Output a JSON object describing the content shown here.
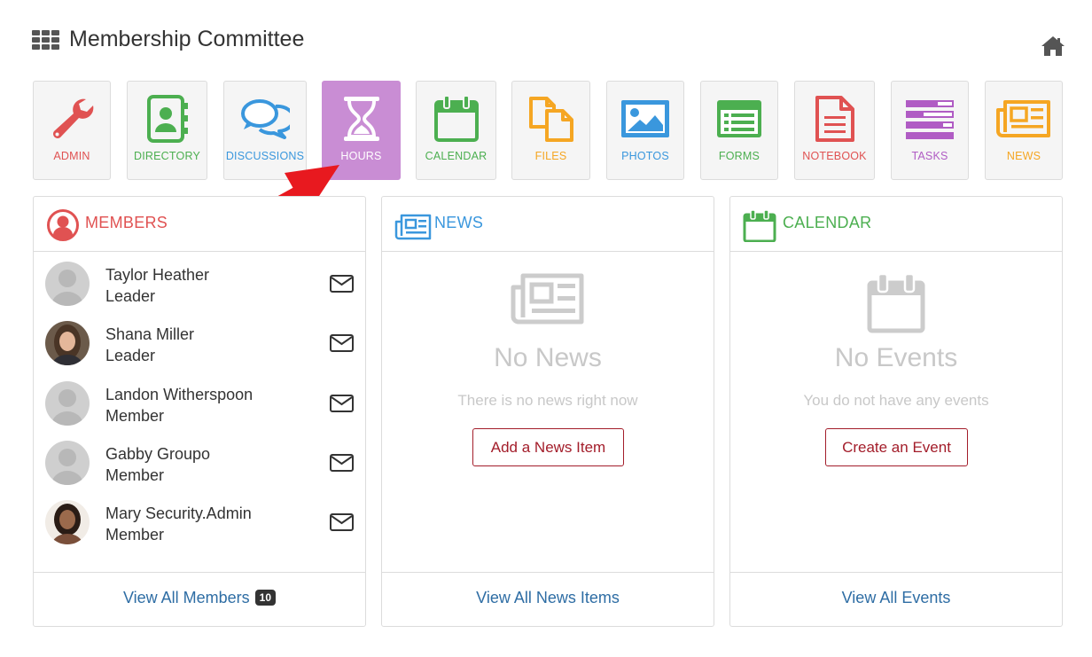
{
  "header": {
    "title": "Membership Committee",
    "apps_icon": "grid-icon",
    "home_icon": "home-icon"
  },
  "tiles": [
    {
      "label": "ADMIN",
      "icon": "wrench-icon",
      "color": "#e05252"
    },
    {
      "label": "DIRECTORY",
      "icon": "address-book-icon",
      "color": "#4caf50"
    },
    {
      "label": "DISCUSSIONS",
      "icon": "chat-bubbles-icon",
      "color": "#3a97dd"
    },
    {
      "label": "HOURS",
      "icon": "hourglass-icon",
      "color": "#ffffff",
      "active": true
    },
    {
      "label": "CALENDAR",
      "icon": "calendar-icon",
      "color": "#4caf50"
    },
    {
      "label": "FILES",
      "icon": "files-icon",
      "color": "#f5a623"
    },
    {
      "label": "PHOTOS",
      "icon": "photo-icon",
      "color": "#3a97dd"
    },
    {
      "label": "FORMS",
      "icon": "form-icon",
      "color": "#4caf50"
    },
    {
      "label": "NOTEBOOK",
      "icon": "notebook-icon",
      "color": "#e05252"
    },
    {
      "label": "TASKS",
      "icon": "tasks-icon",
      "color": "#b05cc4"
    },
    {
      "label": "NEWS",
      "icon": "newspaper-icon",
      "color": "#f5a623"
    }
  ],
  "members_panel": {
    "title": "MEMBERS",
    "title_color": "#e05252",
    "members": [
      {
        "name": "Taylor Heather",
        "role": "Leader",
        "photo": false
      },
      {
        "name": "Shana Miller",
        "role": "Leader",
        "photo": true
      },
      {
        "name": "Landon Witherspoon",
        "role": "Member",
        "photo": false
      },
      {
        "name": "Gabby Groupo",
        "role": "Member",
        "photo": false
      },
      {
        "name": "Mary Security.Admin",
        "role": "Member",
        "photo": true
      }
    ],
    "footer_link": "View All Members",
    "count_badge": "10"
  },
  "news_panel": {
    "title": "NEWS",
    "title_color": "#3a97dd",
    "empty_title": "No News",
    "empty_subtitle": "There is no news right now",
    "action_label": "Add a News Item",
    "footer_link": "View All News Items"
  },
  "calendar_panel": {
    "title": "CALENDAR",
    "title_color": "#4caf50",
    "empty_title": "No Events",
    "empty_subtitle": "You do not have any events",
    "action_label": "Create an Event",
    "footer_link": "View All Events"
  },
  "colors": {
    "link": "#2e6da4",
    "action": "#a31d2a",
    "active_tile": "#c98dd4",
    "annotation_arrow": "#e8191f"
  }
}
